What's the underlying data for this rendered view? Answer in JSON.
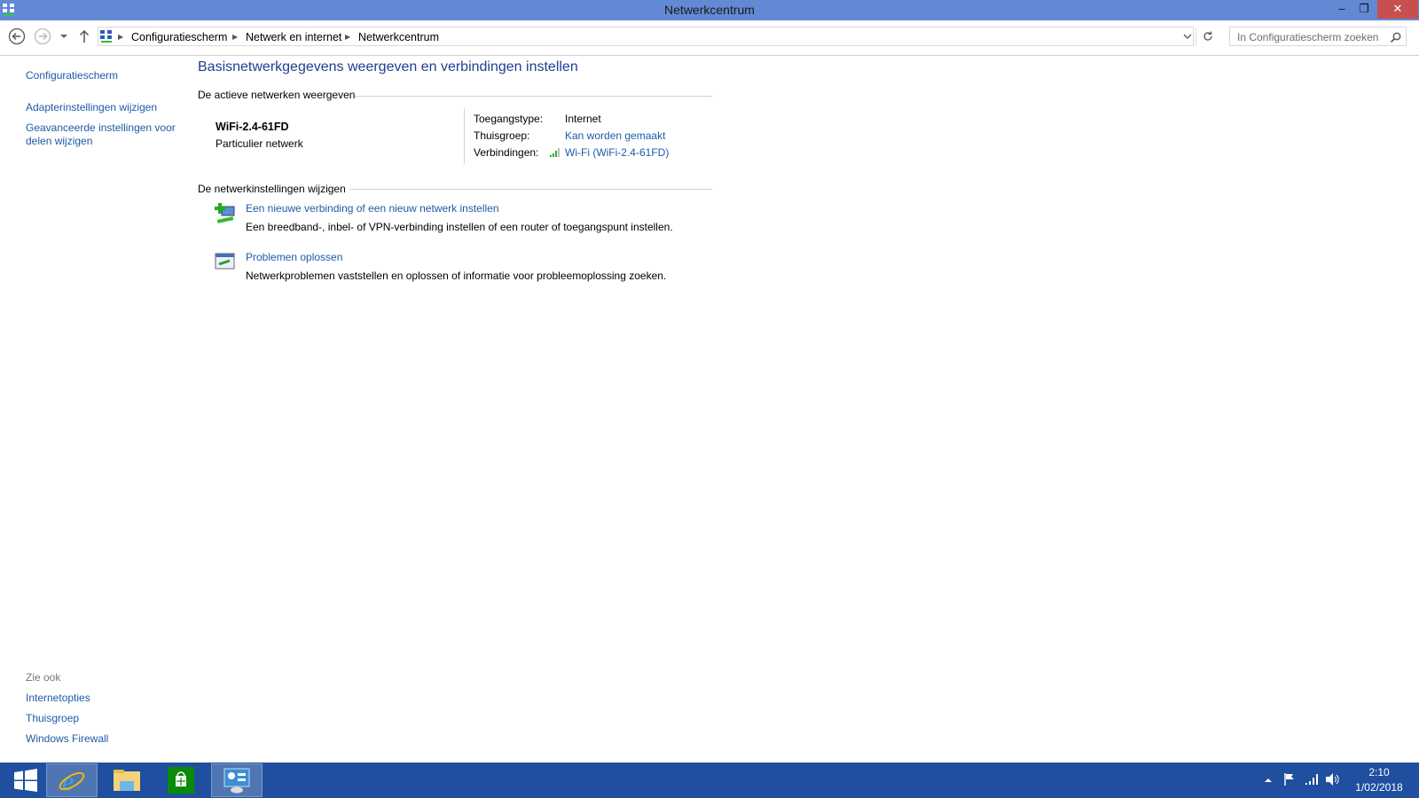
{
  "window": {
    "title": "Netwerkcentrum"
  },
  "breadcrumb": [
    "Configuratiescherm",
    "Netwerk en internet",
    "Netwerkcentrum"
  ],
  "search": {
    "placeholder": "In Configuratiescherm zoeken"
  },
  "sidebar": {
    "links": [
      "Configuratiescherm",
      "Adapterinstellingen wijzigen",
      "Geavanceerde instellingen voor delen wijzigen"
    ],
    "see_also_title": "Zie ook",
    "see_also": [
      "Internetopties",
      "Thuisgroep",
      "Windows Firewall"
    ]
  },
  "main": {
    "heading": "Basisnetwerkgegevens weergeven en verbindingen instellen",
    "active_section": "De actieve netwerken weergeven",
    "network": {
      "name": "WiFi-2.4-61FD",
      "type": "Particulier netwerk",
      "access_label": "Toegangstype:",
      "access_value": "Internet",
      "homegroup_label": "Thuisgroep:",
      "homegroup_value": "Kan worden gemaakt",
      "connections_label": "Verbindingen:",
      "connections_value": "Wi-Fi (WiFi-2.4-61FD)"
    },
    "change_section": "De netwerkinstellingen wijzigen",
    "tasks": [
      {
        "title": "Een nieuwe verbinding of een nieuw netwerk instellen",
        "desc": "Een breedband-, inbel- of VPN-verbinding instellen of een router of toegangspunt instellen."
      },
      {
        "title": "Problemen oplossen",
        "desc": "Netwerkproblemen vaststellen en oplossen of informatie voor probleemoplossing zoeken."
      }
    ]
  },
  "taskbar": {
    "time": "2:10",
    "date": "1/02/2018"
  },
  "colors": {
    "titlebar": "#6289d4",
    "taskbar": "#1f4f9e",
    "link": "#1e5aa8",
    "close": "#c7504f"
  }
}
